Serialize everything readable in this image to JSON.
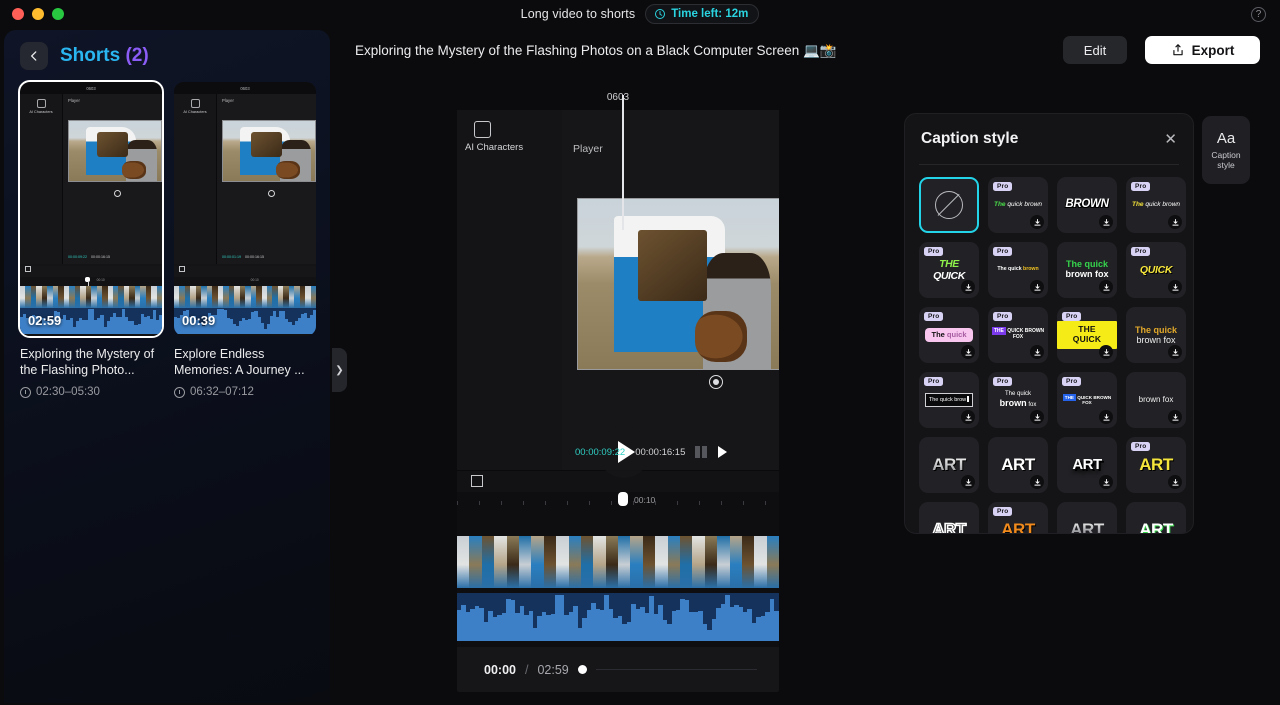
{
  "titlebar": {
    "app_title": "Long video to shorts",
    "time_left": "Time left: 12m",
    "clock_icon": "clock-icon",
    "help_icon": "help-icon"
  },
  "sidebar": {
    "back_icon": "chevron-left-icon",
    "title_main": "Shorts",
    "title_count": "(2)",
    "cards": [
      {
        "duration": "02:59",
        "title": "Exploring the Mystery of the Flashing Photo...",
        "range": "02:30–05:30",
        "mini": {
          "project": "0603",
          "left_panel": "AI Characters",
          "player": "Player",
          "tc_current": "00:00:09:22",
          "tc_total": "00:00:16:15",
          "ruler": "00:10"
        },
        "selected": true
      },
      {
        "duration": "00:39",
        "title": "Explore Endless Memories: A Journey ...",
        "range": "06:32–07:12",
        "mini": {
          "project": "0603",
          "left_panel": "AI Characters",
          "player": "Player",
          "tc_current": "00:00:01:19",
          "tc_total": "00:00:16:15",
          "ruler": "00:10"
        },
        "selected": false
      }
    ],
    "collapse_icon": "chevron-right-icon"
  },
  "header": {
    "video_title": "Exploring the Mystery of the Flashing Photos on a Black Computer Screen 💻📸",
    "edit_label": "Edit",
    "export_label": "Export",
    "export_icon": "share-upload-icon"
  },
  "editor": {
    "project_name": "0603",
    "ai_characters_label": "AI Characters",
    "ai_characters_icon": "ai-character-icon",
    "player_label": "Player",
    "play_icon": "play-icon",
    "record_icon": "record-icon",
    "tc_current": "00:00:09:22",
    "tc_total": "00:00:16:15",
    "pause_icon": "pause-icon",
    "step_play_icon": "play-small-icon",
    "crop_icon": "crop-icon",
    "ruler_time": "00:10",
    "playback_current": "00:00",
    "playback_sep": "/",
    "playback_total": "02:59"
  },
  "caption_panel": {
    "title": "Caption style",
    "close_icon": "close-icon",
    "pro_badge": "Pro",
    "download_icon": "download-icon",
    "items": [
      {
        "id": "none",
        "style": "none",
        "pro": false,
        "download": false,
        "selected": true,
        "text": ""
      },
      {
        "id": "green-white-italic",
        "style": "s-green-wht",
        "pro": true,
        "download": true,
        "selected": false,
        "html": "<b>The</b> <i>quick brown</i>"
      },
      {
        "id": "brown-bold",
        "style": "s-brown",
        "pro": false,
        "download": true,
        "selected": false,
        "text": "BROWN"
      },
      {
        "id": "yellow-white-italic",
        "style": "s-yellowgreen",
        "pro": true,
        "download": true,
        "selected": false,
        "html": "<b>The</b> <i>quick brown</i>"
      },
      {
        "id": "the-quick-green",
        "style": "s-thequick-big",
        "pro": true,
        "download": true,
        "selected": false,
        "html": "<b>THE</b> <i>QUICK</i>"
      },
      {
        "id": "tiny-quick-brown",
        "style": "s-tiny",
        "pro": true,
        "download": true,
        "selected": false,
        "html": "The quick <b>brown</b>"
      },
      {
        "id": "green-brownfox",
        "style": "s-greenwhite2",
        "pro": false,
        "download": true,
        "selected": false,
        "html": "<b>The quick</b><br><i>brown fox</i>"
      },
      {
        "id": "quick-yellow",
        "style": "s-quick-yellow",
        "pro": true,
        "download": true,
        "selected": false,
        "text": "QUICK"
      },
      {
        "id": "pink-highlight",
        "style": "s-pinkbox",
        "pro": true,
        "download": true,
        "selected": false,
        "html": "<b>The</b> <i>quick</i>"
      },
      {
        "id": "purple-tag",
        "style": "s-purple",
        "pro": true,
        "download": true,
        "selected": false,
        "html": "<b>THE</b> QUICK BROWN FOX"
      },
      {
        "id": "yellow-box",
        "style": "s-yellowbox",
        "pro": true,
        "download": true,
        "selected": false,
        "text": "THE QUICK"
      },
      {
        "id": "gold-brownfox",
        "style": "s-gold2",
        "pro": false,
        "download": true,
        "selected": false,
        "html": "<b>The quick</b><br><i>brown fox</i>"
      },
      {
        "id": "typewriter-box",
        "style": "s-typebox",
        "pro": true,
        "download": true,
        "selected": false,
        "text": "The quick brow"
      },
      {
        "id": "mixed-bold",
        "style": "s-mixbold",
        "pro": true,
        "download": true,
        "selected": false,
        "html": "The quick <b>brown</b> fox"
      },
      {
        "id": "blue-tag",
        "style": "s-bluetag",
        "pro": true,
        "download": true,
        "selected": false,
        "html": "<b>THE</b> QUICK BROWN FOX"
      },
      {
        "id": "plain-brownfox",
        "style": "s-plain",
        "pro": false,
        "download": true,
        "selected": false,
        "text": "brown fox"
      },
      {
        "id": "art-grey",
        "style": "s-art-grey",
        "pro": false,
        "download": true,
        "selected": false,
        "text": "ART"
      },
      {
        "id": "art-white",
        "style": "s-art-white",
        "pro": false,
        "download": true,
        "selected": false,
        "text": "ART"
      },
      {
        "id": "art-shadow",
        "style": "s-art-shadow",
        "pro": false,
        "download": true,
        "selected": false,
        "text": "ART"
      },
      {
        "id": "art-yellow",
        "style": "s-art-yellow",
        "pro": true,
        "download": true,
        "selected": false,
        "text": "ART"
      },
      {
        "id": "art-outline",
        "style": "s-art-outline",
        "pro": false,
        "download": false,
        "selected": false,
        "text": "ART"
      },
      {
        "id": "art-orange",
        "style": "s-art-orange",
        "pro": true,
        "download": false,
        "selected": false,
        "text": "ART"
      },
      {
        "id": "art-fade",
        "style": "s-art-fade",
        "pro": false,
        "download": false,
        "selected": false,
        "text": "ART"
      },
      {
        "id": "art-green",
        "style": "s-art-green",
        "pro": false,
        "download": false,
        "selected": false,
        "text": "ART"
      }
    ]
  },
  "rail": {
    "aa_icon": "aa-text-icon",
    "label_line1": "Caption",
    "label_line2": "style"
  },
  "colors": {
    "accent_cyan": "#23d4e8",
    "selected_border": "#23d4e8",
    "timeline_video": "#0d6b63",
    "timeline_audio": "#15325c",
    "export_bg": "#ffffff"
  }
}
